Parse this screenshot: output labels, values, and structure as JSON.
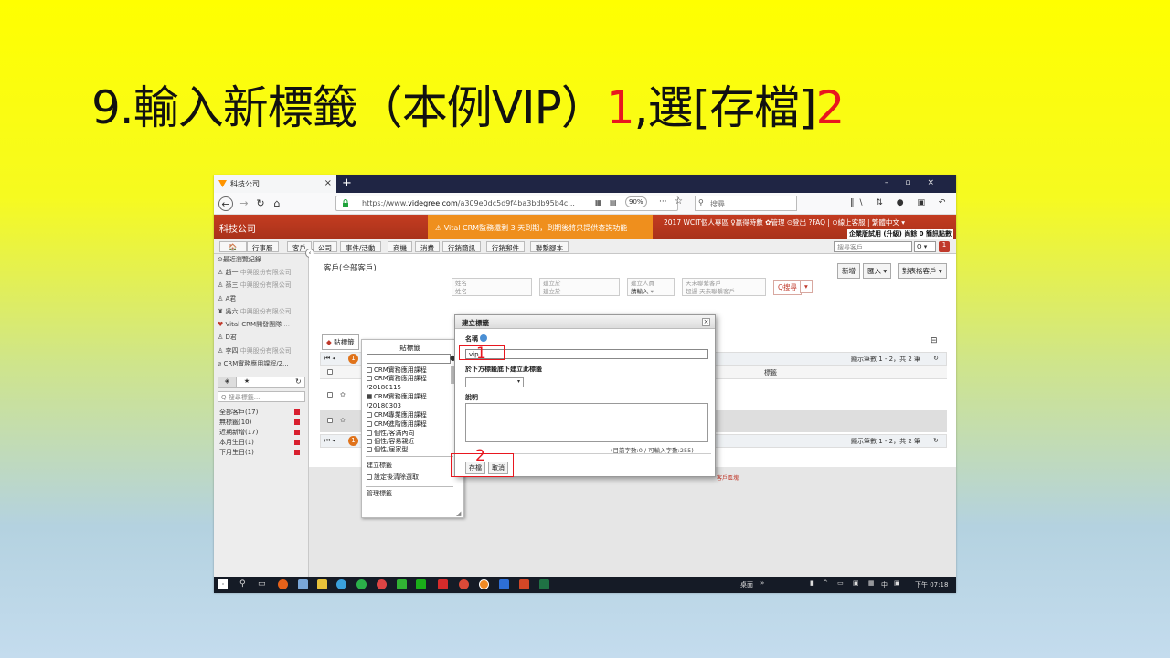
{
  "slide": {
    "title_a": "9.輸入新標籤（本例VIP）",
    "title_b": "1",
    "title_c": ",選[存檔]",
    "title_d": "2"
  },
  "browser": {
    "tab_title": "科技公司",
    "url_prefix": "https://www.",
    "url_host": "videgree.com",
    "url_rest": "/a309e0dc5d9f4ba3bdb95b4c...",
    "zoom": "90%",
    "search_placeholder": "搜尋",
    "more": "···"
  },
  "app": {
    "name": "科技公司",
    "banner": "⚠ Vital CRM監務還剩 3 天到期，到期後將只提供查詢功能",
    "top_menu": "2017 WCIT個人專區  ♀贏得時數  ✿管理  ⊙登出  ?FAQ  |  ⊙線上客服  |  繁體中文 ▾",
    "edition": "企業版試用 (升級)  尚餘 0 簡訊點數"
  },
  "menu": [
    "🏠",
    "行事曆",
    "客戶",
    "公司",
    "事件/活動",
    "商機",
    "消費",
    "行銷簡訊",
    "行銷郵件",
    "聯繫腳本"
  ],
  "find": {
    "placeholder": "搜尋客戶",
    "select": "Q ▾",
    "btn": "1"
  },
  "sidebar": {
    "recent_title": "⊙最近瀏覽紀錄",
    "recent": [
      {
        "name": "趙一",
        "co": "中興股份有限公司"
      },
      {
        "name": "孫三",
        "co": "中興股份有限公司"
      },
      {
        "name": "A君",
        "co": ""
      },
      {
        "name": "吳六",
        "co": "中興股份有限公司"
      },
      {
        "name": "Vital CRM開發團隊",
        "co": "..."
      },
      {
        "name": "D君",
        "co": ""
      },
      {
        "name": "李四",
        "co": "中興股份有限公司"
      },
      {
        "name": "CRM實務應用課程/2...",
        "co": ""
      }
    ],
    "tag_tab_star": "★",
    "tag_search_placeholder": "Q 搜尋標籤...",
    "counts": [
      "全部客戶(17)",
      "無標籤(10)",
      "近期新增(17)",
      "本月生日(1)",
      "下月生日(1)"
    ]
  },
  "main": {
    "crumb": "客戶(全部客戶)",
    "btn_new": "新增",
    "btn_import": "匯入 ▾",
    "btn_table": "對表格客戶 ▾",
    "f_name": "姓名",
    "f_name_ph": "姓名",
    "f_created": "建立於",
    "f_created_ph": "建立於",
    "f_creator": "建立人員",
    "f_creator_val": "請輸入",
    "f_unreach": "天未聯繫客戶",
    "f_unreach_val": "超過",
    "f_unreach_tail": "天未聯繫客戶",
    "f_search": "Q搜尋",
    "tag_btn": "貼標籤",
    "grid_col": "標籤",
    "grid_info": "顯示筆數 1 - 2，共 2 筆",
    "grid_info2": "顯示筆數 1 - 2，共 2 筆",
    "red_link": "客戶區塊"
  },
  "tag_popup": {
    "title": "貼標籤",
    "items": [
      {
        "text": "CRM實務應用課程",
        "checked": false
      },
      {
        "text": "CRM實務應用課程",
        "checked": false
      },
      {
        "text": "/20180115",
        "checked": null
      },
      {
        "text": "CRM實務應用課程",
        "checked": true
      },
      {
        "text": "/20180303",
        "checked": null
      },
      {
        "text": "CRM專業應用課程",
        "checked": false
      },
      {
        "text": "CRM進階應用課程",
        "checked": false
      },
      {
        "text": "個性/客滿內向",
        "checked": false
      },
      {
        "text": "個性/容易親近",
        "checked": false
      },
      {
        "text": "個性/居家型",
        "checked": false
      }
    ],
    "create": "建立標籤",
    "clear_after": "設定後清除選取",
    "manage": "管理標籤"
  },
  "dialog": {
    "title": "建立標籤",
    "name_label": "名稱",
    "name_value": "vip",
    "under_label": "於下方標籤底下建立此標籤",
    "desc_label": "說明",
    "count": "(目前字數:0 / 可輸入字數:255)",
    "save": "存檔",
    "cancel": "取消",
    "close": "×",
    "step1": "1",
    "step2": "2"
  },
  "taskbar": {
    "desktop": "桌面",
    "lang": "中",
    "time": "下午 07:18"
  }
}
